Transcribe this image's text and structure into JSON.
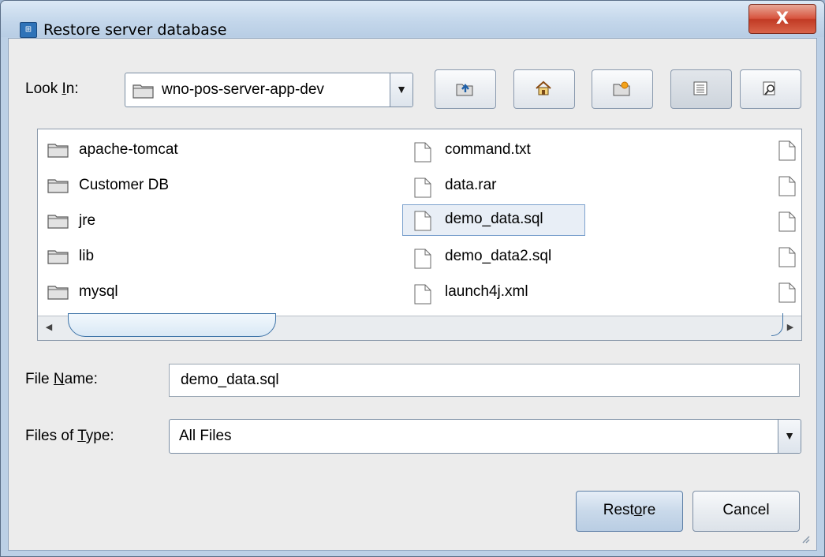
{
  "window": {
    "title": "Restore server database",
    "close_label": "X"
  },
  "lookin": {
    "label_pre": "Look ",
    "label_mnemonic": "I",
    "label_post": "n:",
    "value": "wno-pos-server-app-dev",
    "arrow": "▼"
  },
  "toolbar": {
    "icons": [
      "up-one-level-icon",
      "home-icon",
      "new-folder-icon",
      "list-view-icon",
      "details-view-icon"
    ]
  },
  "files": {
    "column1": [
      "apache-tomcat",
      "Customer DB",
      "jre",
      "lib",
      "mysql"
    ],
    "column2": [
      "command.txt",
      "data.rar",
      "demo_data.sql",
      "demo_data2.sql",
      "launch4j.xml"
    ],
    "selected": "demo_data.sql"
  },
  "scrollbar": {
    "left_arrow": "◀",
    "right_arrow": "▶"
  },
  "filename": {
    "label_pre": "File ",
    "label_mnemonic": "N",
    "label_post": "ame:",
    "value": "demo_data.sql"
  },
  "filetype": {
    "label_pre": "Files of ",
    "label_mnemonic": "T",
    "label_post": "ype:",
    "value": "All Files",
    "arrow": "▼"
  },
  "buttons": {
    "restore_pre": "Rest",
    "restore_mnemonic": "o",
    "restore_post": "re",
    "cancel": "Cancel"
  },
  "colors": {
    "titlebar": "#c4d7eb",
    "dialog_bg": "#ececec",
    "selection_border": "#7da2ce",
    "close_button": "#c13a24"
  }
}
